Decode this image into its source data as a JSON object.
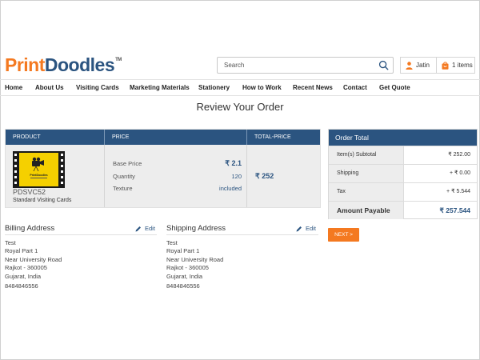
{
  "brand": {
    "logo_part1": "Print",
    "logo_part2": "Doodles",
    "logo_tm": "TM"
  },
  "search": {
    "placeholder": "Search"
  },
  "user": {
    "name": "Jatin",
    "cart_label": "1 items"
  },
  "nav": [
    "Home",
    "About Us",
    "Visiting Cards",
    "Marketing Materials",
    "Stationery",
    "How to Work",
    "Recent News",
    "Contact",
    "Get Quote"
  ],
  "page_title": "Review Your Order",
  "product_table": {
    "headers": [
      "PRODUCT",
      "PRICE",
      "TOTAL-PRICE"
    ],
    "item": {
      "code": "PDSVC52",
      "name": "Standard Visiting Cards",
      "thumb_brand": "PrintDoodles",
      "base_price_label": "Base Price",
      "base_price": "₹ 2.1",
      "quantity_label": "Quantity",
      "quantity": "120",
      "texture_label": "Texture",
      "texture": "included",
      "total_price": "₹ 252"
    }
  },
  "order_total": {
    "title": "Order Total",
    "rows": [
      {
        "label": "Item(s) Subtotal",
        "value": "₹ 252.00"
      },
      {
        "label": "Shipping",
        "value": "+ ₹ 0.00"
      },
      {
        "label": "Tax",
        "value": "+ ₹ 5.544"
      },
      {
        "label": "Amount Payable",
        "value": "₹ 257.544"
      }
    ],
    "next_label": "NEXT >"
  },
  "billing": {
    "title": "Billing Address",
    "edit": "Edit",
    "lines": [
      "Test",
      "Royal Part 1",
      "Near University Road",
      "Rajkot - 360005",
      "Gujarat, India",
      "8484846556"
    ]
  },
  "shipping": {
    "title": "Shipping Address",
    "edit": "Edit",
    "lines": [
      "Test",
      "Royal Part 1",
      "Near University Road",
      "Rajkot - 360005",
      "Gujarat, India",
      "8484846556"
    ]
  },
  "colors": {
    "primary": "#2b5480",
    "accent": "#f47920"
  },
  "icons": {
    "search": "search-icon",
    "user": "user-icon",
    "cart": "cart-icon",
    "edit": "pencil-icon"
  }
}
